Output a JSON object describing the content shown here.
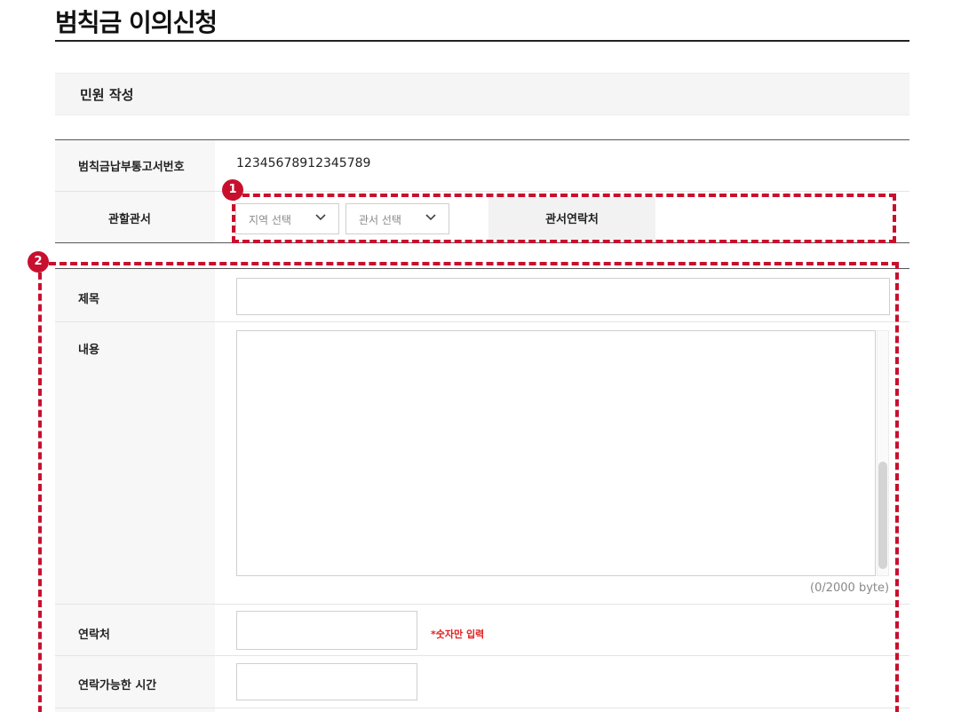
{
  "page": {
    "title": "범칙금 이의신청"
  },
  "section": {
    "title": "민원 작성"
  },
  "form": {
    "notice_number": {
      "label": "범칙금납부통고서번호",
      "value": "12345678912345789"
    },
    "jurisdiction": {
      "label": "관할관서",
      "region_select": "지역 선택",
      "office_select": "관서 선택",
      "office_contact_label": "관서연락처",
      "office_contact_value": ""
    },
    "subject": {
      "label": "제목",
      "value": ""
    },
    "content": {
      "label": "내용",
      "value": "",
      "byte_counter": "(0/2000 byte)"
    },
    "contact": {
      "label": "연락처",
      "value": "",
      "hint": "*숫자만 입력"
    },
    "available_time": {
      "label": "연락가능한 시간",
      "value": ""
    }
  },
  "annotations": [
    {
      "number": "1"
    },
    {
      "number": "2"
    }
  ],
  "colors": {
    "annotation": "#c8102e",
    "hint": "#e02020"
  }
}
